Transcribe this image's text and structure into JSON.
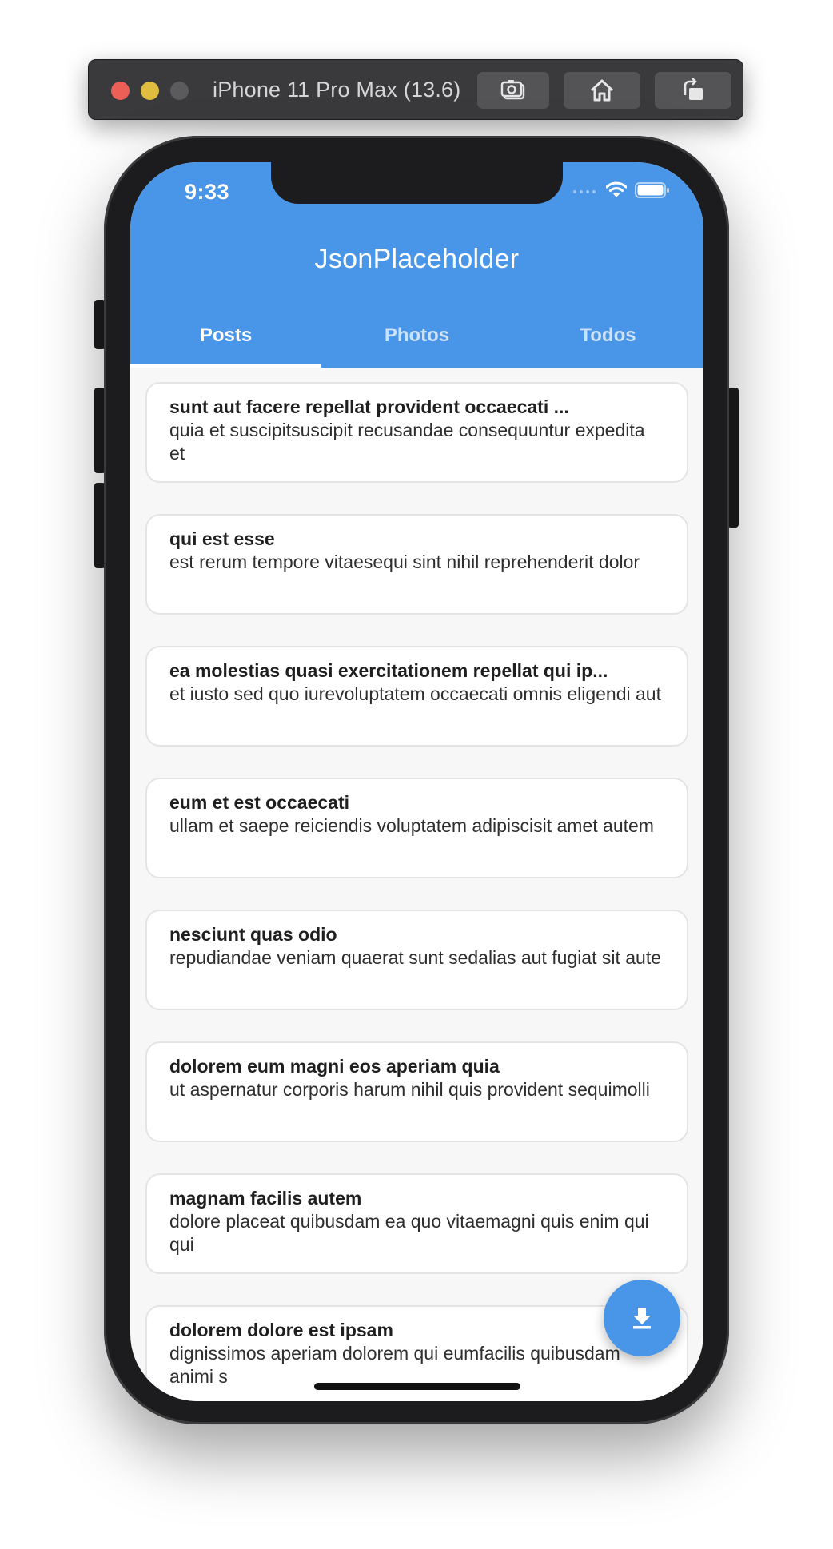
{
  "simulator": {
    "title": "iPhone 11 Pro Max (13.6)",
    "buttons": [
      {
        "icon": "screenshot-icon"
      },
      {
        "icon": "home-icon"
      },
      {
        "icon": "rotate-icon"
      }
    ]
  },
  "status_bar": {
    "time": "9:33"
  },
  "app": {
    "title": "JsonPlaceholder",
    "accent_color": "#4996e8",
    "tabs": [
      {
        "label": "Posts",
        "active": true
      },
      {
        "label": "Photos",
        "active": false
      },
      {
        "label": "Todos",
        "active": false
      }
    ]
  },
  "posts": [
    {
      "title": "sunt aut facere repellat provident occaecati ...",
      "body": "quia et suscipitsuscipit recusandae consequuntur expedita et"
    },
    {
      "title": "qui est esse",
      "body": "est rerum tempore vitaesequi sint nihil reprehenderit dolor"
    },
    {
      "title": "ea molestias quasi exercitationem repellat qui ip...",
      "body": "et iusto sed quo iurevoluptatem occaecati omnis eligendi aut"
    },
    {
      "title": "eum et est occaecati",
      "body": "ullam et saepe reiciendis voluptatem adipiscisit amet autem"
    },
    {
      "title": "nesciunt quas odio",
      "body": "repudiandae veniam quaerat sunt sedalias aut fugiat sit aute"
    },
    {
      "title": "dolorem eum magni eos aperiam quia",
      "body": "ut aspernatur corporis harum nihil quis provident sequimolli"
    },
    {
      "title": "magnam facilis autem",
      "body": "dolore placeat quibusdam ea quo vitaemagni quis enim qui qui"
    },
    {
      "title": "dolorem dolore est ipsam",
      "body": "dignissimos aperiam dolorem qui eumfacilis quibusdam animi s"
    }
  ],
  "fab": {
    "icon": "download-icon"
  }
}
